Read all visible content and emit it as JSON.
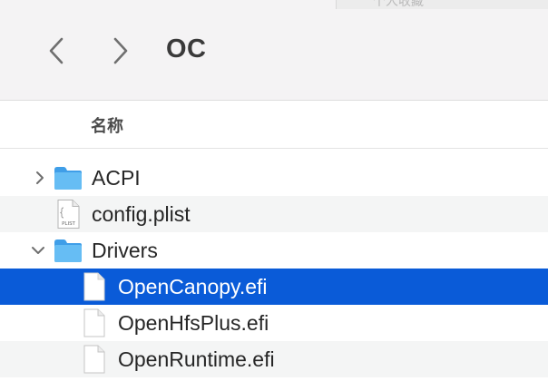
{
  "toolbar": {
    "title": "OC",
    "partial_header_text": "个人收藏"
  },
  "columns": {
    "name_label": "名称"
  },
  "rows": [
    {
      "label": "ACPI",
      "icon": "folder-icon",
      "disclosure": "collapsed",
      "level": 0
    },
    {
      "label": "config.plist",
      "icon": "plist-file-icon",
      "icon_text": "PLIST",
      "disclosure": "none",
      "level": 0
    },
    {
      "label": "Drivers",
      "icon": "folder-icon",
      "disclosure": "expanded",
      "level": 0
    },
    {
      "label": "OpenCanopy.efi",
      "icon": "document-icon",
      "disclosure": "none",
      "level": 1,
      "selected": true
    },
    {
      "label": "OpenHfsPlus.efi",
      "icon": "document-icon",
      "disclosure": "none",
      "level": 1
    },
    {
      "label": "OpenRuntime.efi",
      "icon": "document-icon",
      "disclosure": "none",
      "level": 1
    }
  ],
  "colors": {
    "selection": "#0a5bd8",
    "folder": "#5fb8f3",
    "toolbar_bg": "#f4f3f4",
    "alt_row": "#f4f5f5"
  }
}
